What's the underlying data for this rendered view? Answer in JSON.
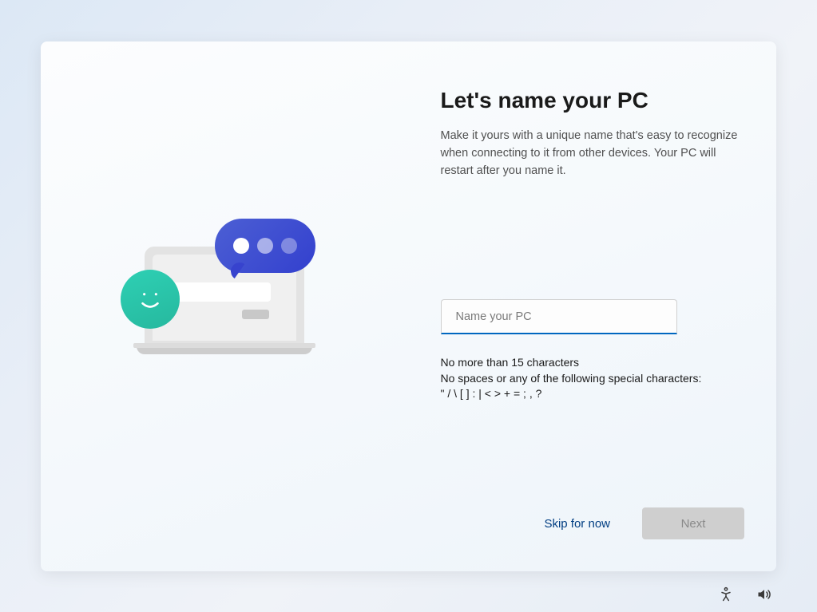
{
  "header": {
    "title": "Let's name your PC",
    "description": "Make it yours with a unique name that's easy to recognize when connecting to it from other devices. Your PC will restart after you name it."
  },
  "input": {
    "value": "",
    "placeholder": "Name your PC"
  },
  "hints": {
    "line1": "No more than 15 characters",
    "line2": "No spaces or any of the following special characters:",
    "line3": "\" / \\ [ ] : | < > + = ; , ?"
  },
  "buttons": {
    "skip": "Skip for now",
    "next": "Next"
  }
}
